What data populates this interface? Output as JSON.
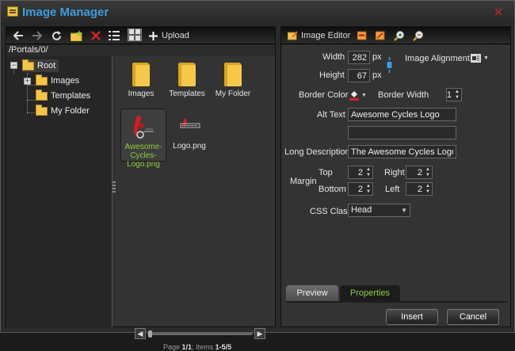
{
  "window": {
    "title": "Image Manager",
    "close_glyph": "✕"
  },
  "browser_toolbar": {
    "items": [
      {
        "name": "back-icon"
      },
      {
        "name": "forward-icon"
      },
      {
        "name": "refresh-icon"
      },
      {
        "name": "new-folder-icon"
      },
      {
        "name": "delete-icon"
      },
      {
        "name": "list-view-icon"
      },
      {
        "name": "thumbnail-view-icon"
      }
    ],
    "upload_label": "Upload"
  },
  "path": "/Portals/0/",
  "tree": {
    "root": {
      "label": "Root",
      "expander": "−"
    },
    "children": [
      {
        "label": "Images",
        "expander": "+"
      },
      {
        "label": "Templates"
      },
      {
        "label": "My Folder"
      }
    ]
  },
  "files": [
    {
      "caption": "Images",
      "kind": "folder"
    },
    {
      "caption": "Templates",
      "kind": "folder"
    },
    {
      "caption": "My Folder",
      "kind": "folder"
    },
    {
      "caption": "Awesome-Cycles-Logo.png",
      "kind": "image",
      "selected": true
    },
    {
      "caption": "Logo.png",
      "kind": "image"
    }
  ],
  "pager": {
    "prev": "◀",
    "next": "▶"
  },
  "page_info": {
    "page_label": "Page",
    "page": "1/1",
    "items_label": "Items",
    "items": "1-5/5"
  },
  "editor_toolbar": {
    "image_editor_label": "Image Editor",
    "icons": [
      "editor-tool-icon-1",
      "editor-tool-icon-2",
      "zoom-in-icon",
      "zoom-out-icon"
    ]
  },
  "properties": {
    "width_label": "Width",
    "width_value": "282",
    "width_unit": "px",
    "height_label": "Height",
    "height_value": "67",
    "height_unit": "px",
    "alignment_label": "Image Alignment",
    "border_color_label": "Border Color",
    "border_width_label": "Border Width",
    "border_width_value": "1",
    "alt_text_label": "Alt Text",
    "alt_text_value": "Awesome Cycles Logo",
    "alt_text_value2": "",
    "long_desc_label": "Long Description",
    "long_desc_value": "The Awesome Cycles Logo",
    "margin_label": "Margin",
    "top_label": "Top",
    "top_value": "2",
    "right_label": "Right",
    "right_value": "2",
    "bottom_label": "Bottom",
    "bottom_value": "2",
    "left_label": "Left",
    "left_value": "2",
    "css_class_label": "CSS Class",
    "css_class_value": "Head"
  },
  "tabs": [
    {
      "label": "Preview"
    },
    {
      "label": "Properties",
      "active": true
    }
  ],
  "actions": {
    "insert": "Insert",
    "cancel": "Cancel"
  },
  "colors": {
    "title": "#3e9de0",
    "selected_text": "#8ecf3a",
    "folder": "#f3c54b"
  }
}
